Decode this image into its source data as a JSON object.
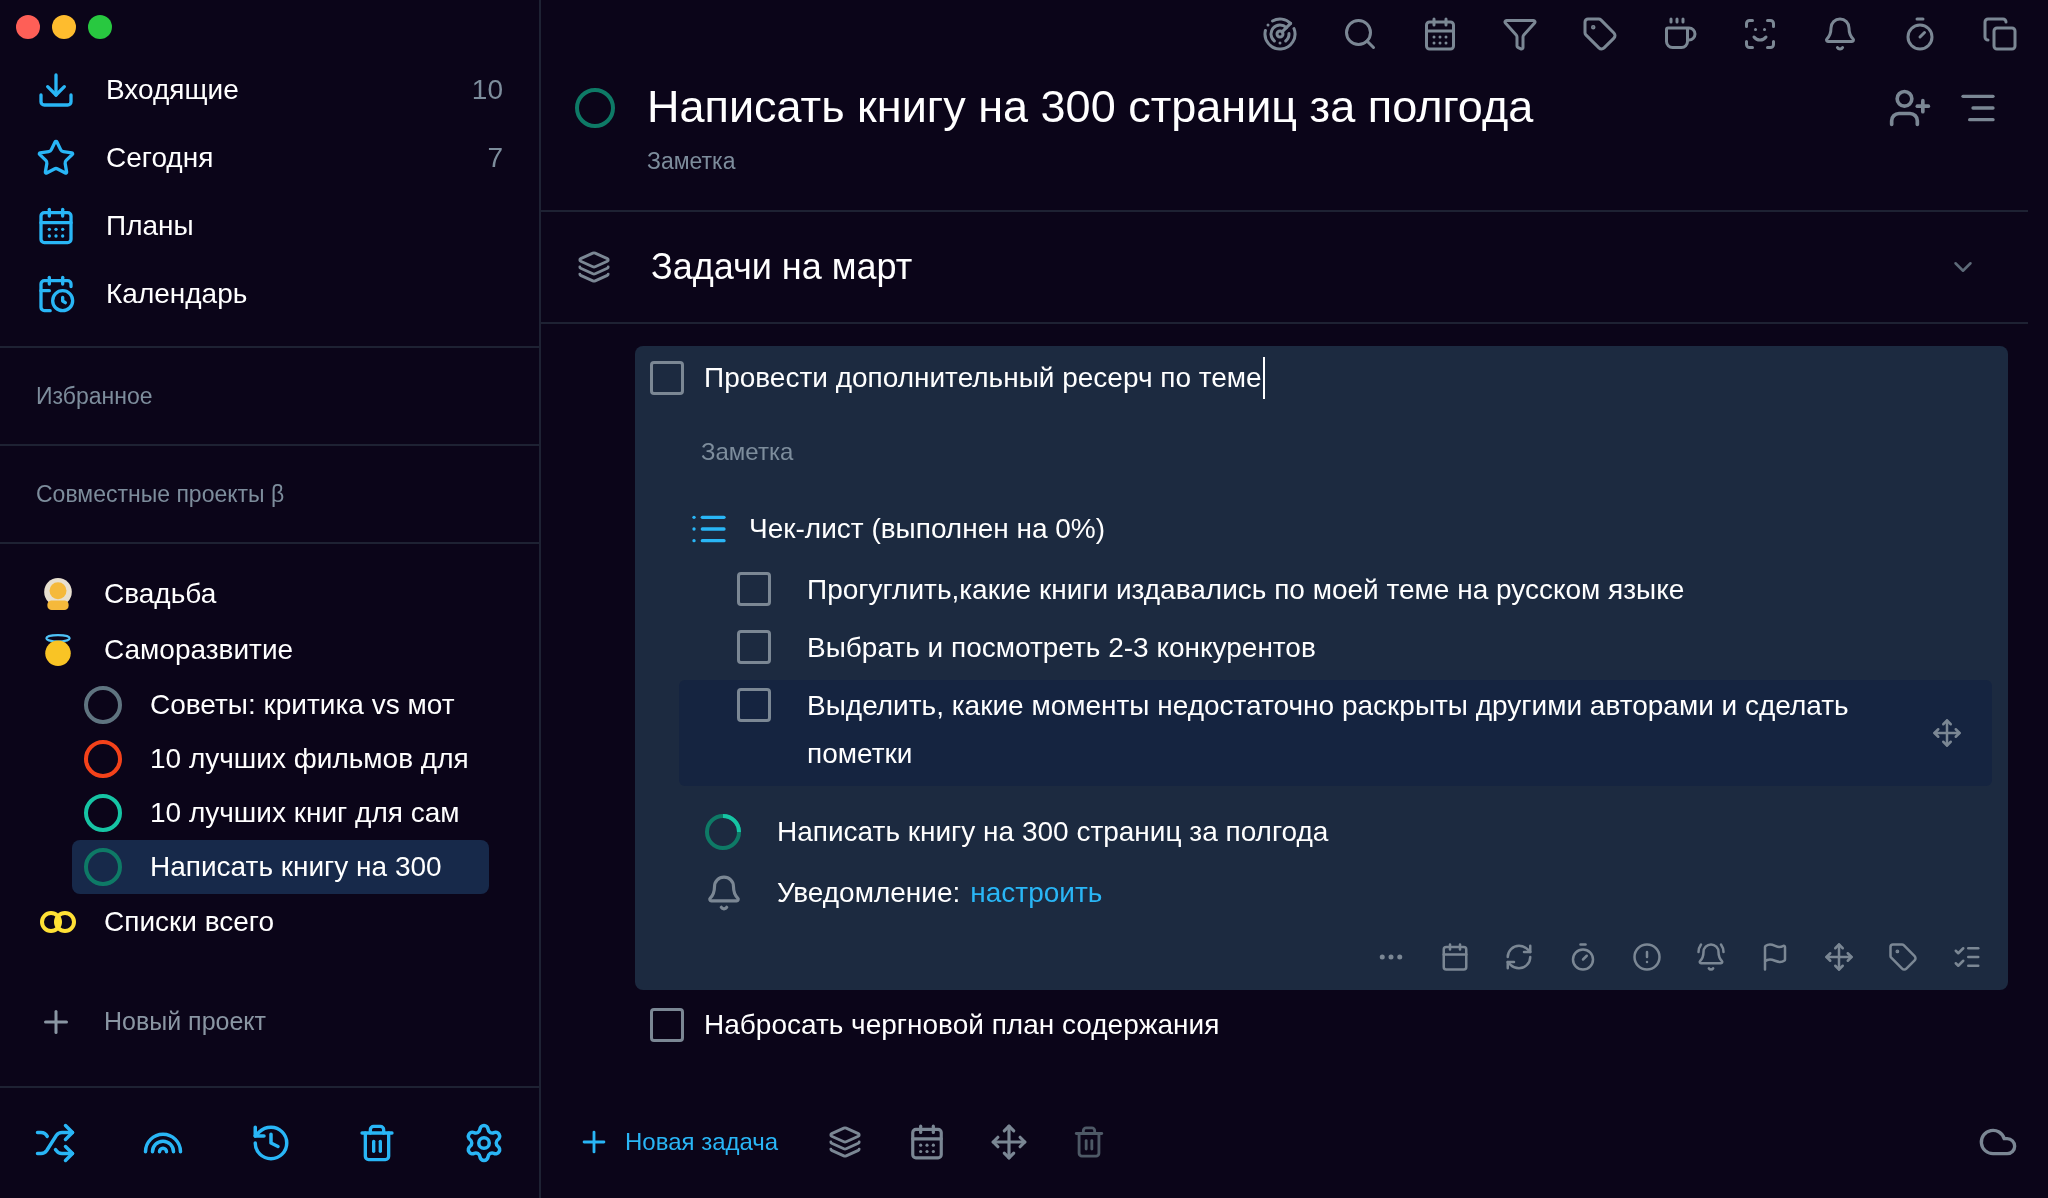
{
  "sidebar": {
    "nav": [
      {
        "kind": "inbox",
        "label": "Входящие",
        "count": "10"
      },
      {
        "kind": "today",
        "label": "Сегодня",
        "count": "7"
      },
      {
        "kind": "plans",
        "label": "Планы"
      },
      {
        "kind": "calendar",
        "label": "Календарь"
      }
    ],
    "favorites_header": "Избранное",
    "shared_header": "Совместные проекты β",
    "projects": [
      {
        "kind": "veil",
        "label": "Свадьба"
      },
      {
        "kind": "halo",
        "label": "Саморазвитие",
        "children": [
          {
            "label": "Советы: критика vs мот",
            "color": "#5f7480",
            "selected": false
          },
          {
            "label": "10 лучших фильмов для",
            "color": "#f4421a",
            "selected": false
          },
          {
            "label": "10 лучших книг для сам",
            "color": "#16c4a4",
            "selected": false
          },
          {
            "label": "Написать книгу на 300",
            "color": "#0e7a66",
            "selected": true
          }
        ]
      },
      {
        "kind": "rings",
        "label": "Списки всего"
      }
    ],
    "new_project": "Новый проект"
  },
  "project": {
    "title": "Написать книгу на 300 страниц за полгода",
    "color": "#0e7a66",
    "note_placeholder": "Заметка"
  },
  "section": {
    "title": "Задачи на март",
    "expanded": true
  },
  "tasks": [
    {
      "kind": "open",
      "title": "Провести дополнительный ресерч по теме",
      "checked": false,
      "note_placeholder": "Заметка",
      "checklist": {
        "title": "Чек-лист (выполнен на 0%)",
        "items": [
          {
            "text": "Прогуглить,какие книги издавались по моей теме на русском языке",
            "checked": false,
            "selected": false
          },
          {
            "text": "Выбрать и посмотреть 2-3 конкурентов",
            "checked": false,
            "selected": false
          },
          {
            "text": "Выделить, какие моменты недостаточно раскрыты другими авторами и сделать пометки",
            "checked": false,
            "selected": true
          }
        ]
      },
      "project": "Написать книгу на 300 страниц за полгода",
      "notification_label": "Уведомление:",
      "notification_link": "настроить"
    },
    {
      "kind": "plain",
      "title": "Набросать чергновой план содержания",
      "checked": false
    }
  ],
  "bottom_bar": {
    "new_task": "Новая задача"
  }
}
